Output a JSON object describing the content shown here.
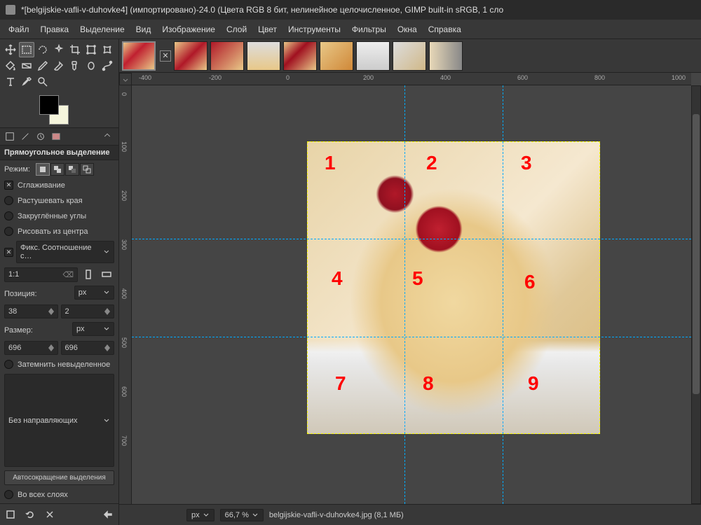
{
  "title": "*[belgijskie-vafli-v-duhovke4] (импортировано)-24.0 (Цвета RGB 8 бит, нелинейное целочисленное, GIMP built-in sRGB, 1 сло",
  "menu": [
    "Файл",
    "Правка",
    "Выделение",
    "Вид",
    "Изображение",
    "Слой",
    "Цвет",
    "Инструменты",
    "Фильтры",
    "Окна",
    "Справка"
  ],
  "tool_options": {
    "title": "Прямоугольное выделение",
    "mode_label": "Режим:",
    "antialias": "Сглаживание",
    "feather": "Растушевать края",
    "rounded": "Закруглённые углы",
    "from_center": "Рисовать из центра",
    "fixed": "Фикс.  Соотношение с…",
    "ratio": "1:1",
    "position_label": "Позиция:",
    "pos_x": "38",
    "pos_y": "2",
    "size_label": "Размер:",
    "size_w": "696",
    "size_h": "696",
    "darken": "Затемнить невыделенное",
    "guides": "Без направляющих",
    "autoshrink": "Автосокращение выделения",
    "all_layers": "Во всех слоях",
    "unit": "px"
  },
  "ruler_h": [
    "-400",
    "-200",
    "0",
    "200",
    "400",
    "600",
    "800",
    "1000"
  ],
  "ruler_v": [
    "0",
    "100",
    "200",
    "300",
    "400",
    "500",
    "600",
    "700"
  ],
  "grid_nums": [
    "1",
    "2",
    "3",
    "4",
    "5",
    "6",
    "7",
    "8",
    "9"
  ],
  "status": {
    "unit": "px",
    "zoom": "66,7 %",
    "file": "belgijskie-vafli-v-duhovke4.jpg (8,1 МБ)"
  }
}
